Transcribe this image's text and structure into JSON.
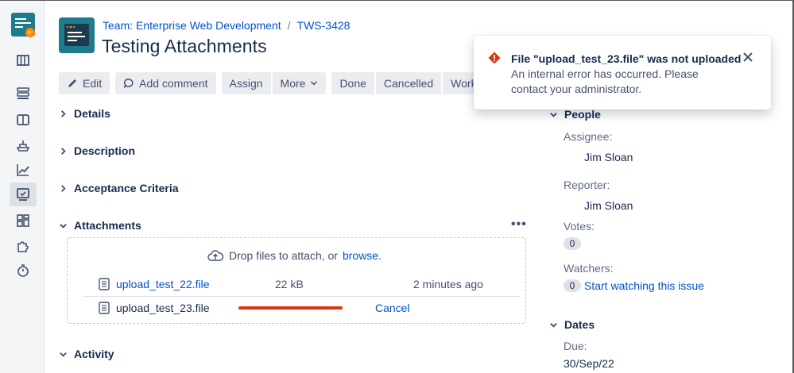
{
  "breadcrumb": {
    "team": "Team: Enterprise Web Development",
    "separator": "/",
    "issue_key": "TWS-3428"
  },
  "page_title": "Testing Attachments",
  "toolbar": {
    "edit": "Edit",
    "add_comment": "Add comment",
    "assign": "Assign",
    "more": "More",
    "done": "Done",
    "cancelled": "Cancelled",
    "workflow": "Workflow"
  },
  "sections": {
    "details": "Details",
    "description": "Description",
    "acceptance": "Acceptance Criteria",
    "attachments": "Attachments",
    "activity": "Activity"
  },
  "attachments": {
    "more_label": "•••",
    "drop_text": "Drop files to attach, or",
    "browse": "browse",
    "browse_suffix": ".",
    "files": [
      {
        "name": "upload_test_22.file",
        "size": "22 kB",
        "date": "2 minutes ago"
      },
      {
        "name": "upload_test_23.file",
        "action": "Cancel"
      }
    ]
  },
  "people": {
    "title": "People",
    "assignee_label": "Assignee:",
    "assignee": "Jim Sloan",
    "reporter_label": "Reporter:",
    "reporter": "Jim Sloan",
    "votes_label": "Votes:",
    "votes": "0",
    "watchers_label": "Watchers:",
    "watchers": "0",
    "watch_link": "Start watching this issue"
  },
  "dates": {
    "title": "Dates",
    "due_label": "Due:",
    "due": "30/Sep/22"
  },
  "flag": {
    "title": "File \"upload_test_23.file\" was not uploaded",
    "body": "An internal error has occurred. Please contact your administrator."
  },
  "colors": {
    "accent": "#0052cc",
    "error": "#de350b",
    "text": "#172b4d"
  }
}
